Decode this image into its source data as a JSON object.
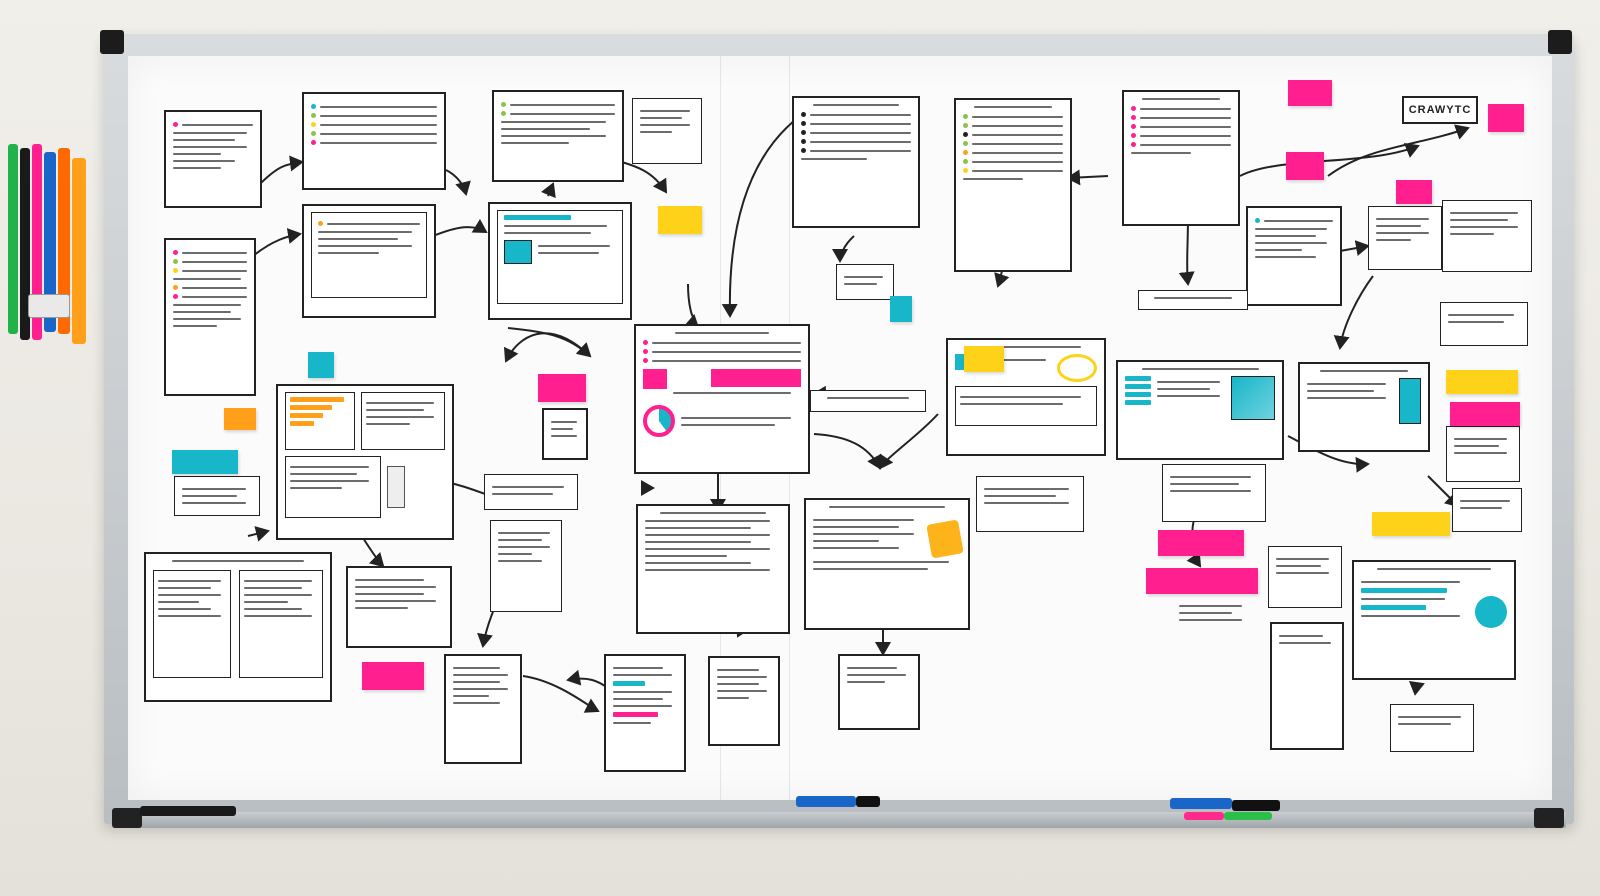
{
  "scene": "whiteboard-flowchart",
  "board_title_label": "CRAWYTC",
  "colors": {
    "board": "#fbfbfb",
    "frame": "#c4c8cb",
    "ink": "#222222",
    "sticky_magenta": "#ff1f8f",
    "sticky_yellow": "#ffd21a",
    "sticky_cyan": "#18b6c9",
    "sticky_orange": "#ff9f1a",
    "accent_green": "#8bc34a"
  },
  "markers_on_tray": [
    {
      "color": "#1a66c8",
      "cap": "#111111"
    },
    {
      "color": "#ff2a8a",
      "cap": "#1a1a1a"
    },
    {
      "color": "#2bbf4a",
      "cap": "#1a1a1a"
    },
    {
      "color": "#1a66c8",
      "cap": "#222222"
    }
  ],
  "marker_holder_colors": [
    "#1a1a1a",
    "#21b34a",
    "#ff1f8f",
    "#1a66c8",
    "#ff9f1a",
    "#ff6a00"
  ],
  "icons": [
    "pie-chart-icon",
    "document-icon",
    "book-icon",
    "chart-icon"
  ]
}
